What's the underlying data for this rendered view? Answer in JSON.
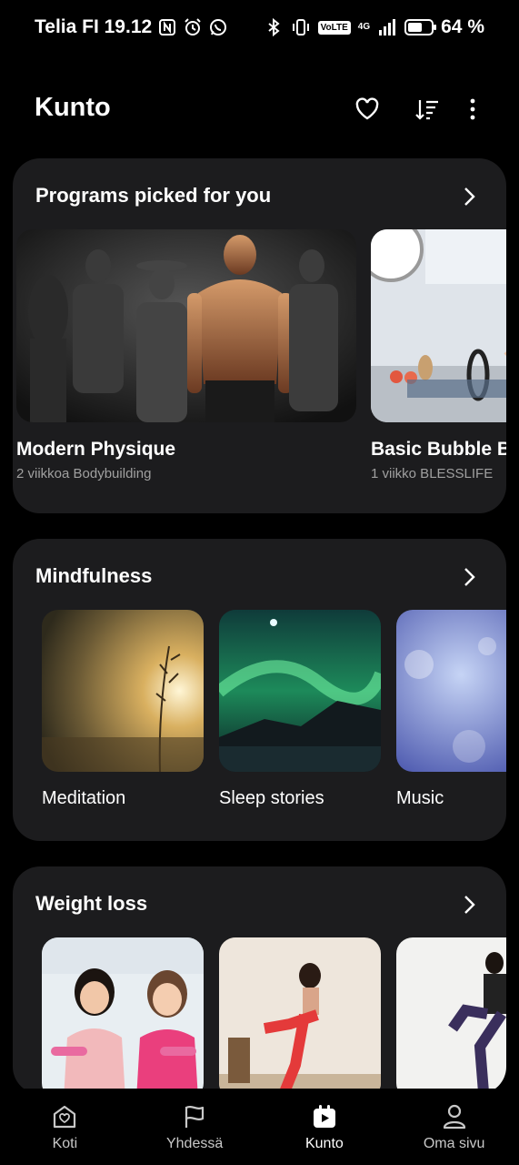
{
  "status": {
    "carrier_time": "Telia FI 19.12",
    "volte": "VoLTE",
    "network": "4G",
    "battery": "64 %",
    "battery_level": 0.64
  },
  "header": {
    "title": "Kunto"
  },
  "programs": {
    "title": "Programs picked for you",
    "items": [
      {
        "name": "Modern Physique",
        "meta": "2 viikkoa Bodybuilding"
      },
      {
        "name": "Basic Bubble B",
        "meta": "1 viikko BLESSLIFE"
      }
    ]
  },
  "mindfulness": {
    "title": "Mindfulness",
    "items": [
      {
        "label": "Meditation"
      },
      {
        "label": "Sleep stories"
      },
      {
        "label": "Music"
      }
    ]
  },
  "weight_loss": {
    "title": "Weight loss"
  },
  "nav": {
    "items": [
      {
        "label": "Koti"
      },
      {
        "label": "Yhdessä"
      },
      {
        "label": "Kunto"
      },
      {
        "label": "Oma sivu"
      }
    ]
  }
}
